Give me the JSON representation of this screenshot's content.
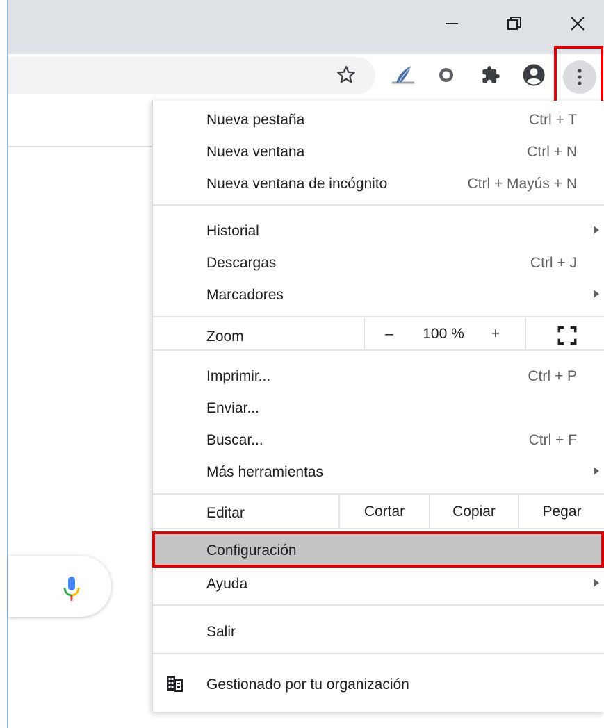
{
  "window": {
    "buttons": [
      {
        "name": "minimize",
        "icon": "minimize-icon"
      },
      {
        "name": "restore",
        "icon": "restore-icon"
      },
      {
        "name": "close",
        "icon": "close-icon"
      }
    ]
  },
  "toolbar": {
    "icons": [
      "star-icon",
      "extension-quill-icon",
      "extension-circle-icon",
      "puzzle-icon",
      "profile-icon",
      "kebab-menu-icon"
    ]
  },
  "menu": {
    "group1": [
      {
        "label": "Nueva pestaña",
        "shortcut": "Ctrl + T"
      },
      {
        "label": "Nueva ventana",
        "shortcut": "Ctrl + N"
      },
      {
        "label": "Nueva ventana de incógnito",
        "shortcut": "Ctrl + Mayús + N"
      }
    ],
    "group2": [
      {
        "label": "Historial",
        "submenu": true
      },
      {
        "label": "Descargas",
        "shortcut": "Ctrl + J"
      },
      {
        "label": "Marcadores",
        "submenu": true
      }
    ],
    "zoom": {
      "label": "Zoom",
      "minus": "–",
      "value": "100 %",
      "plus": "+"
    },
    "group3": [
      {
        "label": "Imprimir...",
        "shortcut": "Ctrl + P"
      },
      {
        "label": "Enviar..."
      },
      {
        "label": "Buscar...",
        "shortcut": "Ctrl + F"
      },
      {
        "label": "Más herramientas",
        "submenu": true
      }
    ],
    "edit": {
      "label": "Editar",
      "cut": "Cortar",
      "copy": "Copiar",
      "paste": "Pegar"
    },
    "settings": {
      "label": "Configuración"
    },
    "help": {
      "label": "Ayuda"
    },
    "exit": {
      "label": "Salir"
    },
    "managed": {
      "label": "Gestionado por tu organización",
      "icon": "building-icon"
    }
  },
  "colors": {
    "highlight_red": "#e00000",
    "selected_bg": "#c4c4c4"
  }
}
